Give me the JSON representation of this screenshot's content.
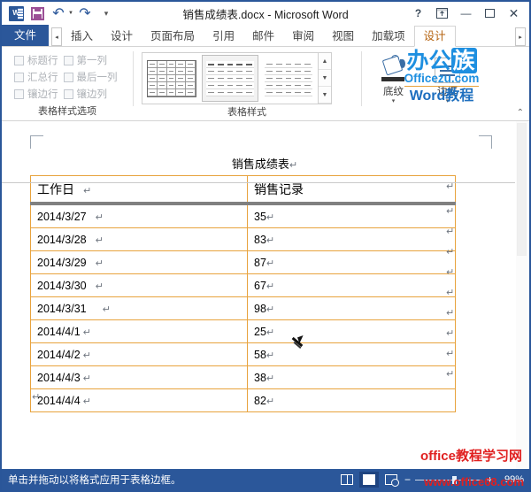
{
  "window": {
    "title": "销售成绩表.docx - Microsoft Word",
    "quick_access": {
      "app_icon": "word-icon",
      "save": "save-icon",
      "undo": "undo-icon",
      "redo": "redo-icon",
      "customize": "customize-quick-access-icon"
    },
    "controls": {
      "help": "?",
      "ribbon_display": "⛶",
      "minimize": "—",
      "maximize": "▢",
      "close": "✕"
    }
  },
  "tabs": {
    "file": "文件",
    "scroll_left": "◂",
    "scroll_right": "▸",
    "items": [
      {
        "label": "插入",
        "active": false
      },
      {
        "label": "设计",
        "active": false
      },
      {
        "label": "页面布局",
        "active": false
      },
      {
        "label": "引用",
        "active": false
      },
      {
        "label": "邮件",
        "active": false
      },
      {
        "label": "审阅",
        "active": false
      },
      {
        "label": "视图",
        "active": false
      },
      {
        "label": "加载项",
        "active": false
      },
      {
        "label": "设计",
        "active": true
      }
    ]
  },
  "ribbon": {
    "groups": [
      {
        "label": "表格样式选项",
        "checkboxes": [
          {
            "label": "标题行",
            "checked": false,
            "disabled": true
          },
          {
            "label": "第一列",
            "checked": false,
            "disabled": true
          },
          {
            "label": "汇总行",
            "checked": false,
            "disabled": true
          },
          {
            "label": "最后一列",
            "checked": false,
            "disabled": true
          },
          {
            "label": "镶边行",
            "checked": false,
            "disabled": true
          },
          {
            "label": "镶边列",
            "checked": false,
            "disabled": true
          }
        ]
      },
      {
        "label": "表格样式",
        "gallery": [
          {
            "name": "table-style-grid",
            "selected": false
          },
          {
            "name": "table-style-header",
            "selected": true
          },
          {
            "name": "table-style-plain",
            "selected": false
          }
        ],
        "scroll_up": "▲",
        "scroll_down": "▼",
        "more": "▼"
      },
      {
        "label": "",
        "buttons": [
          {
            "label": "底纹",
            "icon": "shading-icon",
            "dropdown": "▾"
          },
          {
            "label": "边框",
            "icon": "borders-icon",
            "dropdown": "▾"
          }
        ]
      }
    ],
    "collapse": "⌃"
  },
  "logo": {
    "line1_a": "办公",
    "line1_b": "族",
    "line2": "Officezu.com",
    "line3": "Word教程"
  },
  "document": {
    "title": "销售成绩表",
    "paragraph_mark": "↵",
    "table": {
      "headers": [
        "工作日",
        "销售记录"
      ],
      "rows": [
        [
          "2014/3/27",
          "35"
        ],
        [
          "2014/3/28",
          "83"
        ],
        [
          "2014/3/29",
          "87"
        ],
        [
          "2014/3/30",
          "67"
        ],
        [
          "2014/3/31",
          "98"
        ],
        [
          "2014/4/1",
          "25"
        ],
        [
          "2014/4/2",
          "58"
        ],
        [
          "2014/4/3",
          "38"
        ],
        [
          "2014/4/4",
          "82"
        ]
      ],
      "border_color": "#e8a33d",
      "header_underline_color": "#808080"
    },
    "watermark": {
      "line1": "office教程学习网",
      "line2": "www.office68.com",
      "color": "#e02020"
    },
    "cursor": "border-painter-cursor"
  },
  "status_bar": {
    "message": "单击并拖动以将格式应用于表格边框。",
    "views": [
      {
        "name": "read-mode-view",
        "active": false
      },
      {
        "name": "print-layout-view",
        "active": true
      },
      {
        "name": "web-layout-view",
        "active": false
      }
    ],
    "zoom": {
      "minus": "−",
      "plus": "+",
      "value": "99%"
    },
    "background": "#2b579a"
  }
}
